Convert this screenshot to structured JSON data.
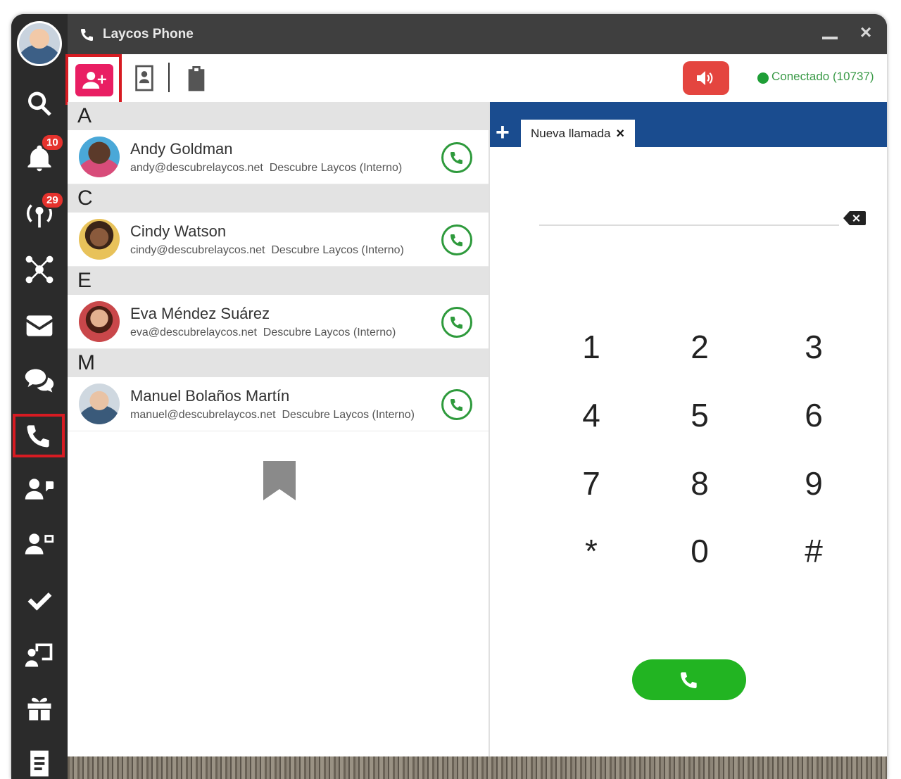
{
  "window": {
    "title": "Laycos Phone",
    "minimize_label": "",
    "close_label": "×"
  },
  "sidebar": {
    "badges": {
      "notifications": "10",
      "broadcast": "29"
    },
    "items": [
      "search-icon",
      "bell-icon",
      "broadcast-icon",
      "network-icon",
      "mail-icon",
      "chat-icon",
      "phone-icon",
      "support-chat-icon",
      "support-agent-icon",
      "check-icon",
      "presentation-icon",
      "gift-icon",
      "document-icon"
    ],
    "selected": "phone-icon"
  },
  "toolbar": {
    "status_text": "Conectado (10737)",
    "status_color": "#1e9e36",
    "accent_color": "#e91e63"
  },
  "contacts": {
    "groups": [
      {
        "letter": "A",
        "name": "Andy Goldman",
        "email": "andy@descubrelaycos.net",
        "org": "Descubre Laycos (Interno)"
      },
      {
        "letter": "C",
        "name": "Cindy Watson",
        "email": "cindy@descubrelaycos.net",
        "org": "Descubre Laycos (Interno)"
      },
      {
        "letter": "E",
        "name": "Eva Méndez Suárez",
        "email": "eva@descubrelaycos.net",
        "org": "Descubre Laycos (Interno)"
      },
      {
        "letter": "M",
        "name": "Manuel Bolaños Martín",
        "email": "manuel@descubrelaycos.net",
        "org": "Descubre Laycos (Interno)"
      }
    ]
  },
  "dialer": {
    "new_tab_label": "+",
    "tab_label": "Nueva llamada",
    "tab_close": "×",
    "number_value": "",
    "keys": [
      "1",
      "2",
      "3",
      "4",
      "5",
      "6",
      "7",
      "8",
      "9",
      "*",
      "0",
      "#"
    ],
    "tab_bar_color": "#1a4c8f",
    "call_button_color": "#22b422"
  }
}
